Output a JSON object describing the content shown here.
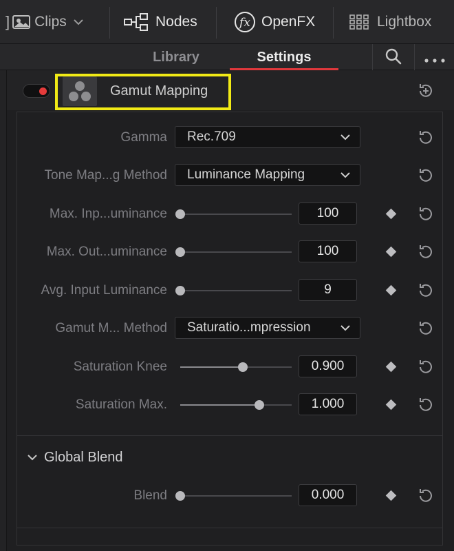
{
  "toolbar": {
    "clips_label": "Clips",
    "nodes_label": "Nodes",
    "openfx_label": "OpenFX",
    "lightbox_label": "Lightbox"
  },
  "tabs": {
    "library": "Library",
    "settings": "Settings"
  },
  "effect": {
    "title": "Gamut Mapping",
    "enabled": true,
    "toggle_color": "#e53b3b",
    "highlight_color": "#f1ea16"
  },
  "params": {
    "gamma": {
      "label": "Gamma",
      "value": "Rec.709"
    },
    "tone_method": {
      "label": "Tone Map...g Method",
      "value": "Luminance Mapping"
    },
    "max_input": {
      "label": "Max. Inp...uminance",
      "value": "100",
      "fraction": 0.0
    },
    "max_output": {
      "label": "Max. Out...uminance",
      "value": "100",
      "fraction": 0.0
    },
    "avg_input": {
      "label": "Avg. Input Luminance",
      "value": "9",
      "fraction": 0.0
    },
    "gamut_method": {
      "label": "Gamut M... Method",
      "value": "Saturatio...mpression"
    },
    "sat_knee": {
      "label": "Saturation Knee",
      "value": "0.900",
      "fraction": 0.56
    },
    "sat_max": {
      "label": "Saturation Max.",
      "value": "1.000",
      "fraction": 0.71
    }
  },
  "global_blend": {
    "section_label": "Global Blend",
    "blend": {
      "label": "Blend",
      "value": "0.000",
      "fraction": 0.0
    }
  },
  "icons": {
    "clips": "clips-icon",
    "nodes": "nodes-icon",
    "openfx": "fx-icon",
    "lightbox": "grid-icon",
    "search": "search-icon",
    "more": "more-icon",
    "reset": "reset-icon",
    "keyframe": "keyframe-diamond-icon"
  }
}
